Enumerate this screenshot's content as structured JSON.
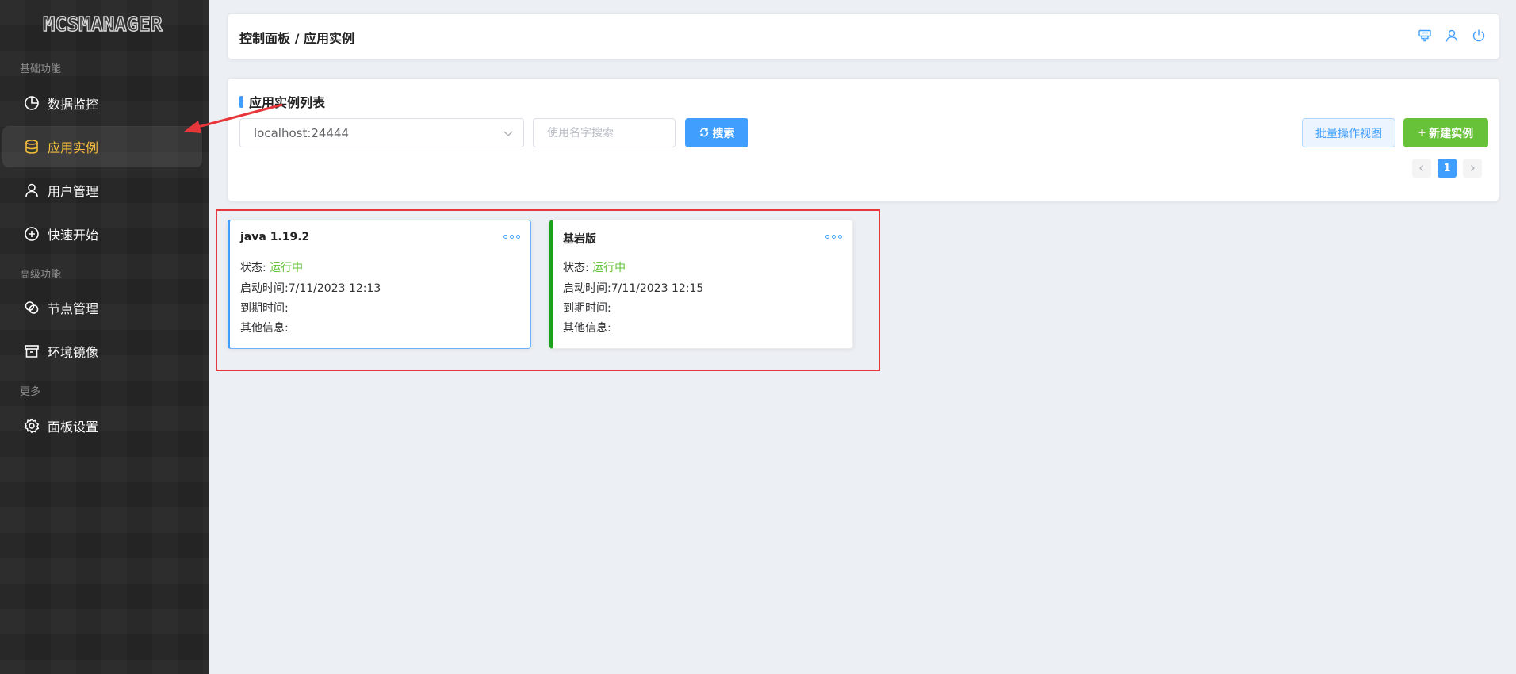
{
  "sidebar": {
    "logo": "MCSMANAGER",
    "sections": {
      "basic": "基础功能",
      "advanced": "高级功能",
      "more": "更多"
    },
    "items": {
      "monitor": "数据监控",
      "instances": "应用实例",
      "users": "用户管理",
      "quickstart": "快速开始",
      "nodes": "节点管理",
      "images": "环境镜像",
      "settings": "面板设置"
    }
  },
  "header": {
    "breadcrumb": "控制面板 / 应用实例"
  },
  "list": {
    "title": "应用实例列表",
    "node_select": "localhost:24444",
    "search_placeholder": "使用名字搜索",
    "search_label": "搜索",
    "batch_label": "批量操作视图",
    "new_label": "新建实例",
    "page_current": "1"
  },
  "instances": [
    {
      "name": "java 1.19.2",
      "status_label": "状态:",
      "status_value": "运行中",
      "start_time": "启动时间:7/11/2023 12:13",
      "expire": "到期时间:",
      "other": "其他信息:"
    },
    {
      "name": "基岩版",
      "status_label": "状态:",
      "status_value": "运行中",
      "start_time": "启动时间:7/11/2023 12:15",
      "expire": "到期时间:",
      "other": "其他信息:"
    }
  ],
  "colors": {
    "accent": "#409eff",
    "success": "#67c23a",
    "active_nav": "#f5bd3c",
    "annotation": "#e8373b"
  }
}
